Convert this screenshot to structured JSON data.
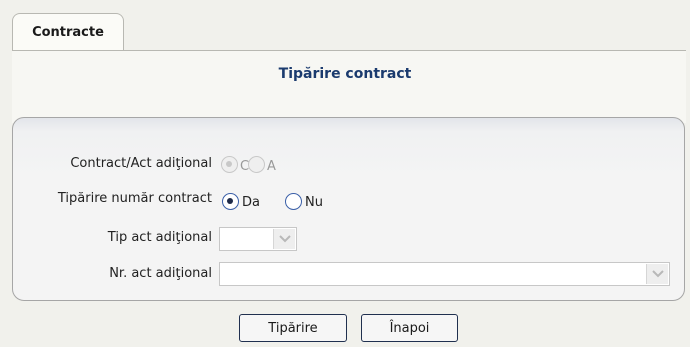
{
  "tabs": [
    {
      "label": "Contracte",
      "active": true
    }
  ],
  "page_title": "Tipărire contract",
  "form": {
    "contract_type": {
      "label": "Contract/Act adiţional",
      "options": [
        {
          "label": "C",
          "selected": true
        },
        {
          "label": "A",
          "selected": false
        }
      ],
      "disabled": true
    },
    "print_number": {
      "label": "Tipărire număr contract",
      "options": [
        {
          "label": "Da",
          "selected": true
        },
        {
          "label": "Nu",
          "selected": false
        }
      ]
    },
    "addendum_type": {
      "label": "Tip act adiţional",
      "value": ""
    },
    "addendum_number": {
      "label": "Nr. act adiţional",
      "value": ""
    }
  },
  "buttons": {
    "print": "Tipărire",
    "back": "Înapoi"
  },
  "colors": {
    "title": "#1b3b6e",
    "radio_border": "#3a5fa8",
    "button_border": "#20304f"
  }
}
